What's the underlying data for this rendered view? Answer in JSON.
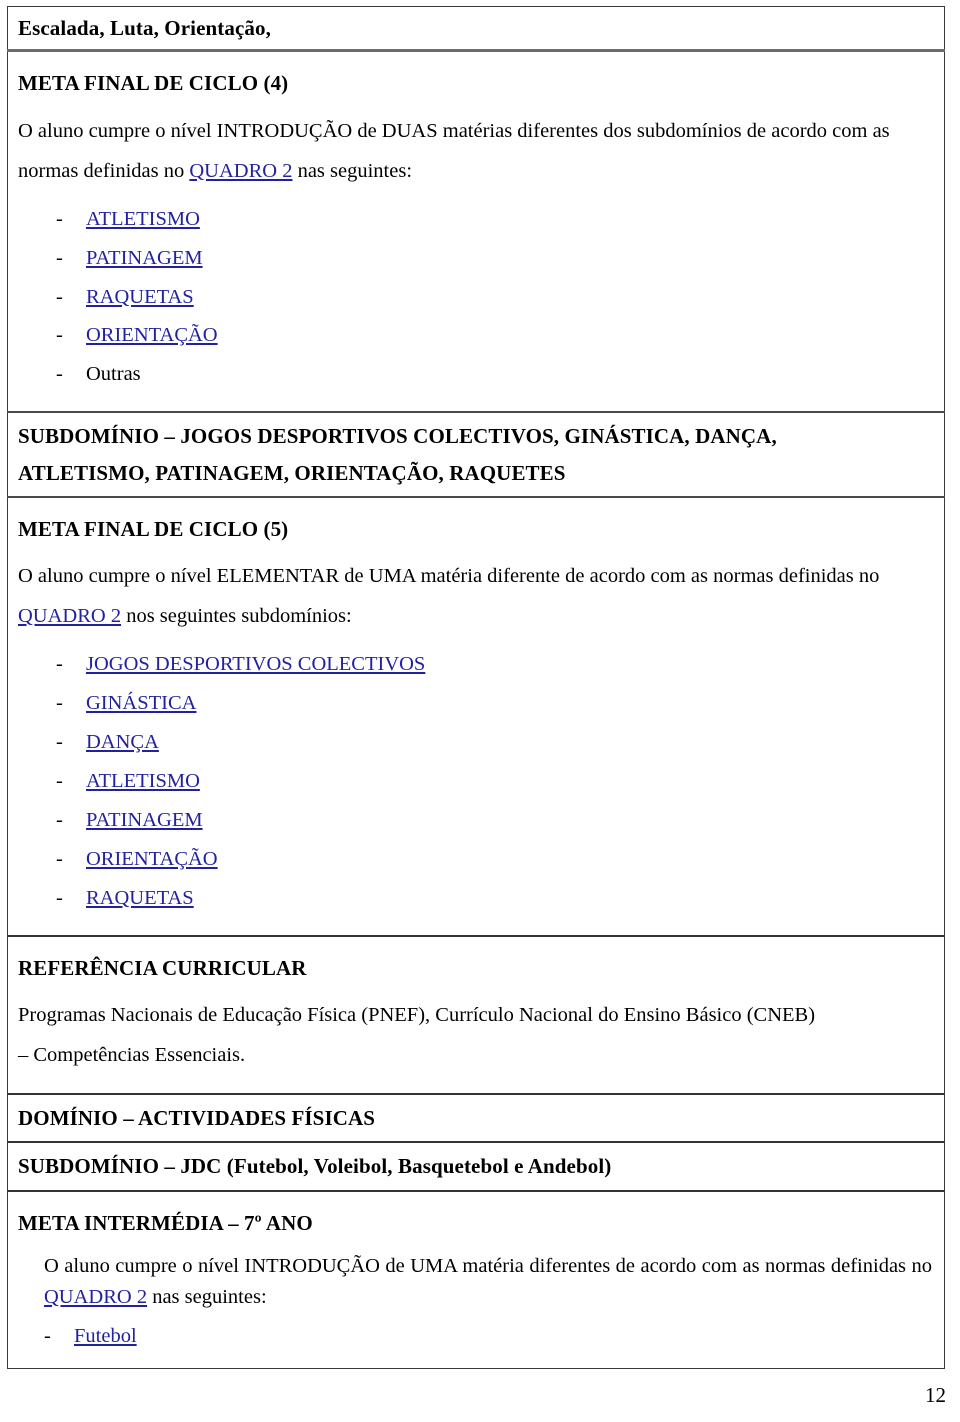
{
  "document": {
    "page_number": "12",
    "link_color": "#2222a0",
    "text_color": "#000000"
  },
  "rows": {
    "header_partial": {
      "text": "Escalada, Luta, Orientação,"
    },
    "meta_final_4": {
      "heading": "META FINAL DE CICLO (4)",
      "paragraph_part1": "O aluno cumpre o nível INTRODUÇÃO de DUAS matérias diferentes dos subdomínios de acordo com as normas definidas no ",
      "paragraph_link": "QUADRO 2",
      "paragraph_part2": " nas seguintes:",
      "items": [
        {
          "label": "ATLETISMO",
          "is_link": true
        },
        {
          "label": "PATINAGEM",
          "is_link": true
        },
        {
          "label": "RAQUETAS",
          "is_link": true
        },
        {
          "label": "ORIENTAÇÃO",
          "is_link": true
        },
        {
          "label": "Outras",
          "is_link": false
        }
      ]
    },
    "subdominio_1": {
      "line1": "SUBDOMÍNIO – JOGOS DESPORTIVOS COLECTIVOS, GINÁSTICA, DANÇA,",
      "line2": "ATLETISMO, PATINAGEM, ORIENTAÇÃO, RAQUETES"
    },
    "meta_final_5": {
      "heading": "META FINAL DE CICLO (5)",
      "paragraph_part1": "O aluno cumpre o nível ELEMENTAR de UMA matéria diferente de acordo com as normas definidas no ",
      "paragraph_link": "QUADRO 2",
      "paragraph_part2": " nos seguintes subdomínios:",
      "items": [
        {
          "label": "JOGOS DESPORTIVOS COLECTIVOS",
          "is_link": true
        },
        {
          "label": "GINÁSTICA",
          "is_link": true
        },
        {
          "label": "DANÇA",
          "is_link": true
        },
        {
          "label": "ATLETISMO",
          "is_link": true
        },
        {
          "label": "PATINAGEM",
          "is_link": true
        },
        {
          "label": "ORIENTAÇÃO",
          "is_link": true
        },
        {
          "label": "RAQUETAS",
          "is_link": true
        }
      ]
    },
    "referencia": {
      "heading": "REFERÊNCIA CURRICULAR",
      "line1": "Programas Nacionais de Educação Física (PNEF), Currículo Nacional do Ensino Básico (CNEB)",
      "line2": "– Competências Essenciais."
    },
    "dominio": {
      "heading": "DOMÍNIO – ACTIVIDADES FÍSICAS"
    },
    "subdominio_2": {
      "heading": "SUBDOMÍNIO – JDC (Futebol, Voleibol, Basquetebol e Andebol)"
    },
    "meta_intermedia": {
      "heading": "META INTERMÉDIA – 7º ANO",
      "paragraph_part1": "O aluno cumpre o nível INTRODUÇÃO de UMA matéria diferentes de acordo com as normas definidas no ",
      "paragraph_link": "QUADRO 2",
      "paragraph_part2": " nas seguintes:",
      "items": [
        {
          "label": "Futebol",
          "is_link": true
        }
      ]
    }
  }
}
